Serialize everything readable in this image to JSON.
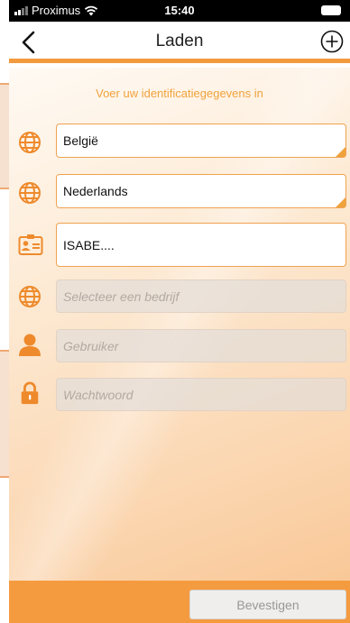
{
  "status_bar": {
    "carrier": "Proximus",
    "time": "15:40"
  },
  "nav": {
    "title": "Laden",
    "back_icon": "chevron-left-icon",
    "add_icon": "plus-circle-icon"
  },
  "instruction": "Voer uw identificatiegegevens in",
  "fields": {
    "country": {
      "value": "België",
      "icon": "globe-icon"
    },
    "language": {
      "value": "Nederlands",
      "icon": "globe-icon"
    },
    "id": {
      "value": "ISABE....",
      "icon": "id-card-icon"
    },
    "company": {
      "placeholder": "Selecteer een bedrijf",
      "icon": "globe-icon"
    },
    "user": {
      "placeholder": "Gebruiker",
      "icon": "user-icon"
    },
    "password": {
      "placeholder": "Wachtwoord",
      "icon": "lock-icon"
    }
  },
  "footer": {
    "confirm_label": "Bevestigen"
  },
  "colors": {
    "accent": "#f39a3e",
    "instruction_text": "#f0a23c",
    "bottom_bar": "#f59b3f"
  }
}
